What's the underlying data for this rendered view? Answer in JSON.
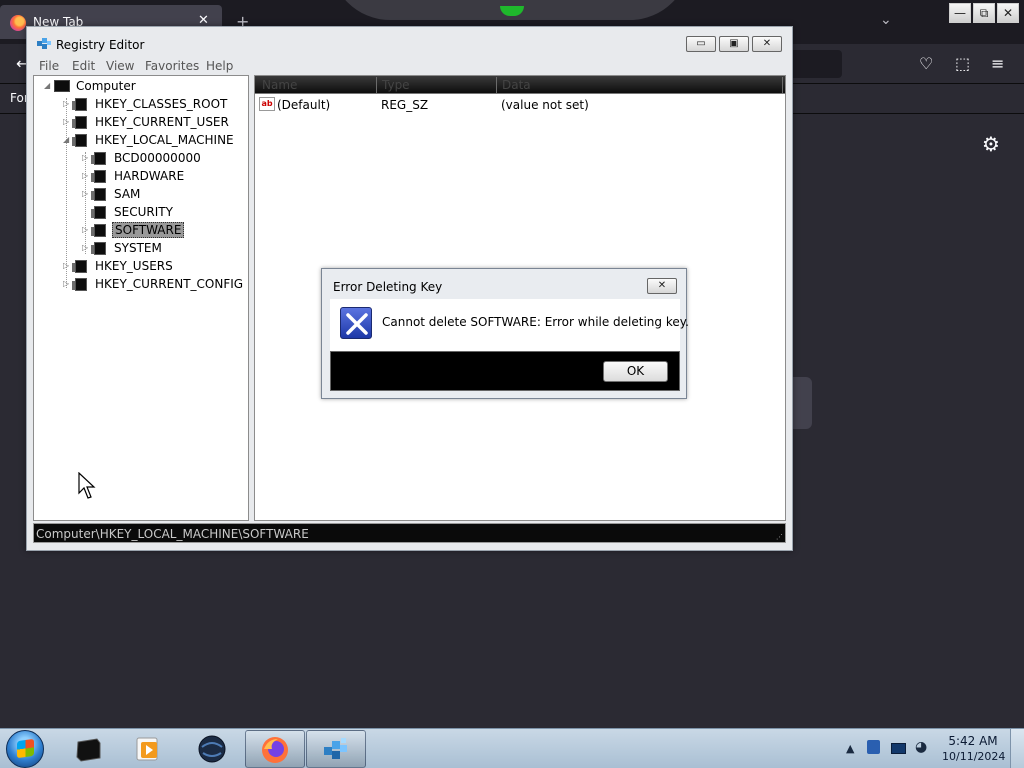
{
  "browser": {
    "tab_title": "New Tab",
    "tab_close": "✕",
    "new_tab": "+",
    "bookmarks_text": "For"
  },
  "window": {
    "title": "Registry Editor",
    "minimize": "▭",
    "maximize": "▣",
    "close": "✕"
  },
  "menu": [
    "File",
    "Edit",
    "View",
    "Favorites",
    "Help"
  ],
  "tree": {
    "root": "Computer",
    "hives": [
      "HKEY_CLASSES_ROOT",
      "HKEY_CURRENT_USER",
      "HKEY_LOCAL_MACHINE"
    ],
    "hklm_children": [
      "BCD00000000",
      "HARDWARE",
      "SAM",
      "SECURITY",
      "SOFTWARE",
      "SYSTEM"
    ],
    "hives_after": [
      "HKEY_USERS",
      "HKEY_CURRENT_CONFIG"
    ],
    "selected": "SOFTWARE"
  },
  "list": {
    "columns": [
      "Name",
      "Type",
      "Data"
    ],
    "rows": [
      {
        "icon": "ab",
        "name": "(Default)",
        "type": "REG_SZ",
        "data": "(value not set)"
      }
    ]
  },
  "statusbar": {
    "path": "Computer\\HKEY_LOCAL_MACHINE\\SOFTWARE"
  },
  "dialog": {
    "title": "Error Deleting Key",
    "message": "Cannot delete SOFTWARE:  Error while deleting key.",
    "ok_label": "OK",
    "close": "✕"
  },
  "taskbar": {
    "time": "5:42 AM",
    "date": "10/11/2024",
    "tray_arrow": "▲"
  },
  "colors": {
    "firefox_bg": "#2b2a33",
    "window_frame": "#e8eaed",
    "selection": "#999999",
    "error_icon": "#1d38a8"
  },
  "icons": [
    "firefox-icon",
    "regedit-icon",
    "computer-icon",
    "folder-icon",
    "error-x-icon",
    "gear-icon",
    "start-orb-icon"
  ]
}
